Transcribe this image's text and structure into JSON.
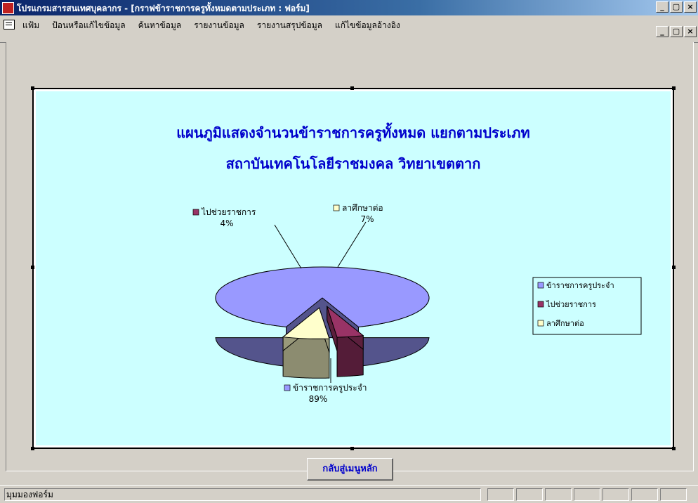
{
  "window": {
    "title": "โปรแกรมสารสนเทศบุคลากร - [กราฟข้าราชการครูทั้งหมดตามประเภท : ฟอร์ม]",
    "minimize": "_",
    "restore": "ð",
    "close": "×"
  },
  "menu": {
    "items": [
      "แฟ้ม",
      "ป้อนหรือแก้ไขข้อมูล",
      "ค้นหาข้อมูล",
      "รายงานข้อมูล",
      "รายงานสรุปข้อมูล",
      "แก้ไขข้อมูลอ้างอิง"
    ]
  },
  "chart_data": {
    "type": "pie",
    "style": "3d-exploded",
    "title": "แผนภูมิแสดงจำนวนข้าราชการครูทั้งหมด แยกตามประเภท",
    "subtitle": "สถาบันเทคโนโลยีราชมงคล วิทยาเขตตาก",
    "slices": [
      {
        "label": "ข้าราชการครูประจำ",
        "value": 89,
        "display": "89%",
        "color": "#9999ff"
      },
      {
        "label": "ไปช่วยราชการ",
        "value": 4,
        "display": "4%",
        "color": "#993366"
      },
      {
        "label": "ลาศึกษาต่อ",
        "value": 7,
        "display": "7%",
        "color": "#ffffcc"
      }
    ],
    "legend_position": "right"
  },
  "back_button": {
    "label": "กลับสู่เมนูหลัก"
  },
  "status": {
    "text": "มุมมองฟอร์ม"
  },
  "icons": {
    "app": "access-app-icon",
    "doc": "form-document-icon"
  }
}
